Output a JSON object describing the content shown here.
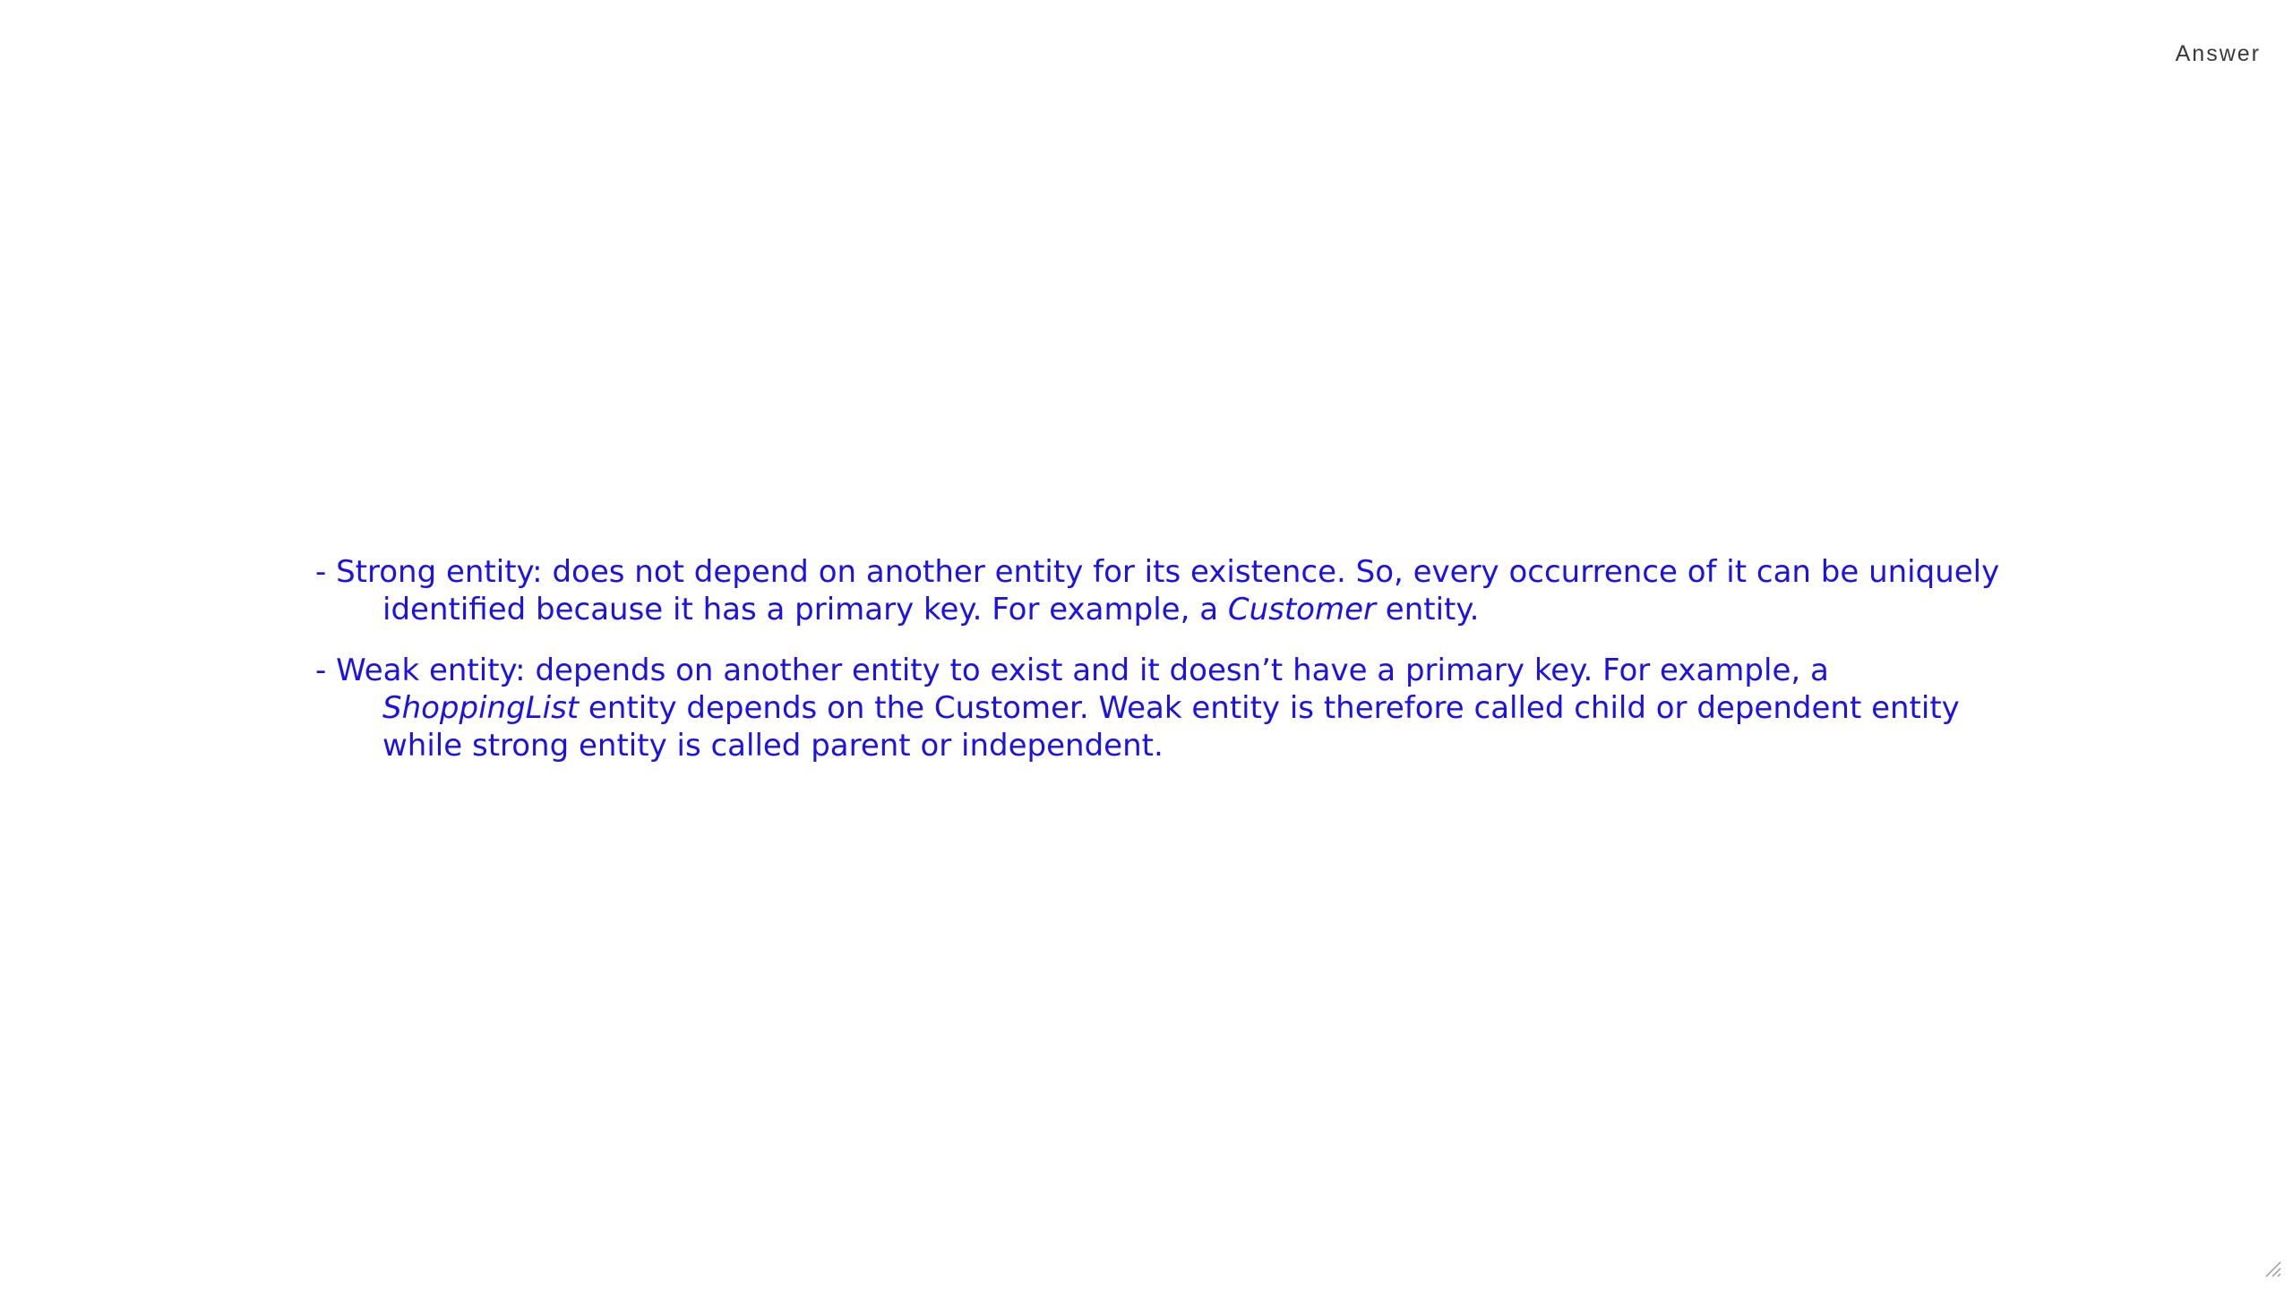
{
  "header": {
    "answer_label": "Answer"
  },
  "bullets": [
    {
      "prefix": "- Strong entity: does not depend on another entity for its existence. So, every occurrence of it can be uniquely identified because it has a primary key. For example, a ",
      "emphasis": "Customer",
      "suffix": " entity."
    },
    {
      "prefix": "- Weak entity: depends on another entity to exist and it doesn’t have a primary key. For example, a ",
      "emphasis": "ShoppingList",
      "suffix": " entity depends on the Customer. Weak entity is therefore called child or dependent entity while strong entity is called parent or independent."
    }
  ],
  "colors": {
    "body_text": "#1a12e6",
    "label_text": "#3a3a3a",
    "background": "#ffffff"
  },
  "icons": {
    "resize_grip": "resize-grip-icon"
  }
}
